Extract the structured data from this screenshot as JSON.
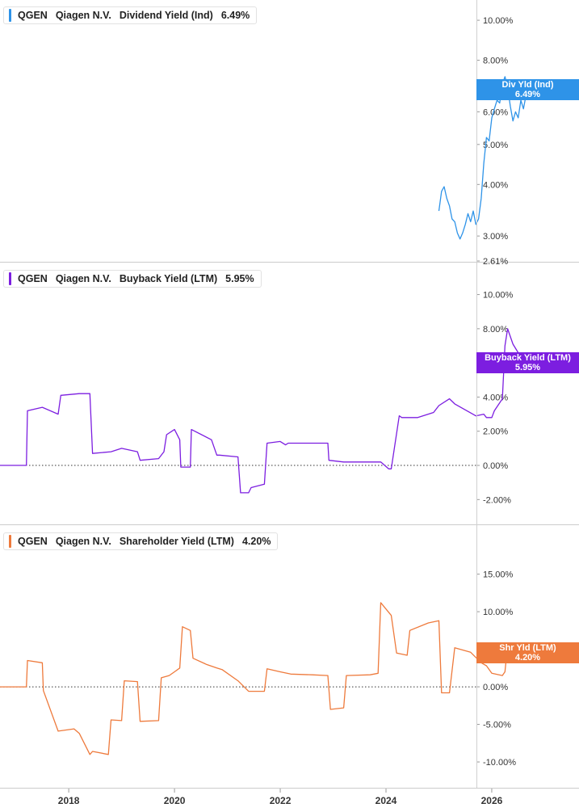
{
  "chart_data": [
    {
      "type": "line",
      "ticker": "QGEN",
      "company": "Qiagen N.V.",
      "metric": "Dividend Yield (Ind)",
      "current_value": "6.49%",
      "callout_label": "Div Yld (Ind)",
      "color": "#2e93e8",
      "y_scale": "log",
      "ylim": [
        2.61,
        10.8
      ],
      "y_ticks": [
        "10.00%",
        "8.00%",
        "7.00%",
        "6.00%",
        "5.00%",
        "4.00%",
        "3.00%",
        "2.61%"
      ],
      "y_tick_values": [
        10,
        8,
        7,
        6,
        5,
        4,
        3,
        2.61
      ],
      "series": [
        {
          "x": [
            2025.0,
            2025.05,
            2025.1,
            2025.15,
            2025.2,
            2025.25,
            2025.3,
            2025.35,
            2025.4,
            2025.45,
            2025.5,
            2025.55,
            2025.6,
            2025.65,
            2025.7,
            2025.75,
            2025.8,
            2025.85,
            2025.9,
            2025.95,
            2026.0,
            2026.05,
            2026.1,
            2026.15,
            2026.2,
            2026.25,
            2026.3,
            2026.35,
            2026.4,
            2026.45,
            2026.5,
            2026.55,
            2026.6,
            2026.65,
            2026.7
          ],
          "values": [
            3.45,
            3.85,
            3.95,
            3.7,
            3.55,
            3.3,
            3.25,
            3.05,
            2.95,
            3.05,
            3.2,
            3.4,
            3.25,
            3.45,
            3.2,
            3.3,
            3.7,
            4.5,
            5.2,
            5.1,
            5.8,
            6.1,
            6.4,
            6.3,
            7.0,
            7.3,
            6.9,
            6.2,
            5.7,
            6.0,
            5.8,
            6.4,
            6.1,
            6.6,
            6.49
          ]
        }
      ]
    },
    {
      "type": "line",
      "ticker": "QGEN",
      "company": "Qiagen N.V.",
      "metric": "Buyback Yield (LTM)",
      "current_value": "5.95%",
      "callout_label": "Buyback Yield (LTM)",
      "color": "#7c1ee0",
      "ylim": [
        -2.6,
        10.5
      ],
      "y_ticks": [
        "10.00%",
        "8.00%",
        "4.00%",
        "2.00%",
        "0.00%",
        "-2.00%"
      ],
      "y_tick_values": [
        10,
        8,
        4,
        2,
        0,
        -2
      ],
      "series": [
        {
          "x": [
            2016.5,
            2017.2,
            2017.22,
            2017.5,
            2017.8,
            2017.85,
            2018.2,
            2018.4,
            2018.45,
            2018.8,
            2019.0,
            2019.3,
            2019.35,
            2019.7,
            2019.8,
            2019.85,
            2020.0,
            2020.1,
            2020.12,
            2020.3,
            2020.32,
            2020.7,
            2020.8,
            2020.85,
            2021.2,
            2021.25,
            2021.4,
            2021.45,
            2021.7,
            2021.75,
            2022.0,
            2022.1,
            2022.15,
            2022.6,
            2022.9,
            2022.92,
            2023.2,
            2023.5,
            2023.9,
            2024.05,
            2024.1,
            2024.25,
            2024.3,
            2024.6,
            2024.9,
            2025.0,
            2025.2,
            2025.3,
            2025.7,
            2025.85,
            2025.9,
            2026.0,
            2026.05,
            2026.2,
            2026.25,
            2026.3,
            2026.4,
            2026.5,
            2026.6,
            2026.7
          ],
          "values": [
            0.0,
            0.0,
            3.2,
            3.4,
            3.0,
            4.1,
            4.2,
            4.2,
            0.7,
            0.8,
            1.0,
            0.8,
            0.3,
            0.4,
            0.8,
            1.8,
            2.1,
            1.5,
            -0.1,
            -0.1,
            2.1,
            1.5,
            0.6,
            0.6,
            0.5,
            -1.6,
            -1.6,
            -1.3,
            -1.1,
            1.3,
            1.4,
            1.2,
            1.3,
            1.3,
            1.3,
            0.3,
            0.2,
            0.2,
            0.2,
            -0.2,
            -0.2,
            2.9,
            2.8,
            2.8,
            3.1,
            3.5,
            3.9,
            3.6,
            2.9,
            3.0,
            2.8,
            2.8,
            3.2,
            3.9,
            7.0,
            8.0,
            7.1,
            6.6,
            6.2,
            5.95
          ]
        }
      ]
    },
    {
      "type": "line",
      "ticker": "QGEN",
      "company": "Qiagen N.V.",
      "metric": "Shareholder Yield (LTM)",
      "current_value": "4.20%",
      "callout_label": "Shr Yld (LTM)",
      "color": "#ee7a3c",
      "ylim": [
        -11.5,
        17
      ],
      "y_ticks": [
        "15.00%",
        "10.00%",
        "5.00%",
        "0.00%",
        "-5.00%",
        "-10.00%"
      ],
      "y_tick_values": [
        15,
        10,
        5,
        0,
        -5,
        -10
      ],
      "series": [
        {
          "x": [
            2016.5,
            2017.0,
            2017.2,
            2017.22,
            2017.5,
            2017.52,
            2017.8,
            2018.1,
            2018.2,
            2018.4,
            2018.45,
            2018.75,
            2018.8,
            2019.0,
            2019.05,
            2019.3,
            2019.35,
            2019.7,
            2019.75,
            2019.9,
            2020.0,
            2020.1,
            2020.15,
            2020.3,
            2020.35,
            2020.6,
            2020.8,
            2020.9,
            2021.2,
            2021.4,
            2021.7,
            2021.75,
            2022.0,
            2022.2,
            2022.6,
            2022.9,
            2022.95,
            2023.2,
            2023.25,
            2023.7,
            2023.85,
            2023.9,
            2024.1,
            2024.2,
            2024.4,
            2024.45,
            2024.8,
            2025.0,
            2025.05,
            2025.2,
            2025.3,
            2025.6,
            2025.8,
            2025.9,
            2026.0,
            2026.2,
            2026.25,
            2026.3,
            2026.35,
            2026.45,
            2026.5,
            2026.6,
            2026.7
          ],
          "values": [
            0.0,
            0.0,
            0.0,
            3.5,
            3.2,
            -0.5,
            -5.9,
            -5.6,
            -6.2,
            -9.0,
            -8.6,
            -9.0,
            -4.4,
            -4.5,
            0.8,
            0.7,
            -4.6,
            -4.5,
            1.2,
            1.5,
            2.0,
            2.5,
            8.0,
            7.5,
            3.8,
            3.0,
            2.5,
            2.3,
            0.8,
            -0.6,
            -0.6,
            2.4,
            2.0,
            1.7,
            1.6,
            1.5,
            -3.0,
            -2.8,
            1.5,
            1.6,
            1.8,
            11.2,
            9.5,
            4.5,
            4.2,
            7.5,
            8.5,
            8.8,
            -0.8,
            -0.8,
            5.2,
            4.6,
            3.2,
            2.8,
            1.8,
            1.5,
            2.0,
            5.5,
            5.0,
            4.5,
            4.4,
            4.2,
            4.2
          ]
        }
      ]
    }
  ],
  "x_axis": {
    "ticks": [
      "2018",
      "2020",
      "2022",
      "2024",
      "2026"
    ],
    "tick_values": [
      2018,
      2020,
      2022,
      2024,
      2026
    ],
    "xlim": [
      2016.7,
      2027.65
    ]
  }
}
